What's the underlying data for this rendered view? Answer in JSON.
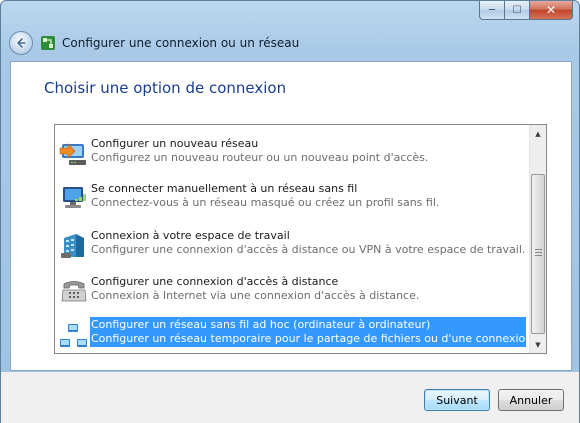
{
  "window": {
    "title": "Configurer une connexion ou un réseau",
    "caption": {
      "minimize": "─",
      "maximize": "☐",
      "close": "✕"
    }
  },
  "main": {
    "heading": "Choisir une option de connexion",
    "options": [
      {
        "title": "Configurer un nouveau réseau",
        "description": "Configurez un nouveau routeur ou un nouveau point d'accès.",
        "icon": "router-setup-icon",
        "selected": false
      },
      {
        "title": "Se connecter manuellement à un réseau sans fil",
        "description": "Connectez-vous à un réseau masqué ou créez un profil sans fil.",
        "icon": "wireless-computer-icon",
        "selected": false
      },
      {
        "title": "Connexion à votre espace de travail",
        "description": "Configurer une connexion d'accès à distance ou VPN à votre espace de travail.",
        "icon": "workplace-building-icon",
        "selected": false
      },
      {
        "title": "Configurer une connexion d'accès à distance",
        "description": "Connexion à Internet via une connexion d'accès à distance.",
        "icon": "dialup-phone-icon",
        "selected": false
      },
      {
        "title": "Configurer un réseau sans fil ad hoc (ordinateur à ordinateur)",
        "description": "Configurer un réseau temporaire pour le partage de fichiers ou d'une connexion Internet.",
        "icon": "adhoc-network-icon",
        "selected": true
      }
    ]
  },
  "footer": {
    "next_label": "Suivant",
    "cancel_label": "Annuler"
  },
  "colors": {
    "heading": "#1a3e8c",
    "selection": "#3399ff"
  }
}
